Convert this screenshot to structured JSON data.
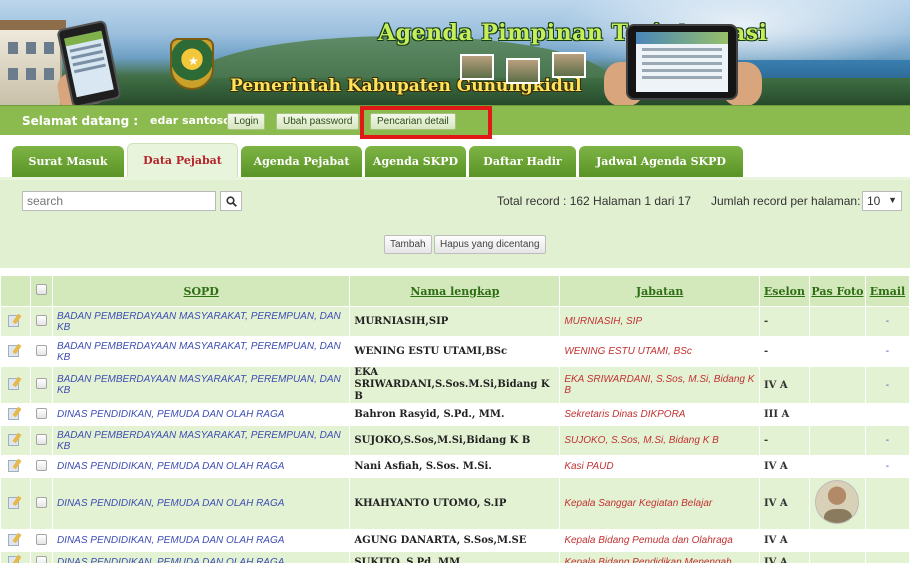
{
  "header": {
    "title": "Agenda Pimpinan Terintegrasi",
    "subtitle": "Pemerintah Kabupaten Gunungkidul"
  },
  "userbar": {
    "greeting": "Selamat datang :",
    "username": "edar santoso",
    "login_label": "Login",
    "change_password_label": "Ubah password",
    "detail_search_label": "Pencarian detail"
  },
  "tabs": [
    {
      "label": "Surat Masuk",
      "active": false
    },
    {
      "label": "Data Pejabat",
      "active": true
    },
    {
      "label": "Agenda Pejabat",
      "active": false
    },
    {
      "label": "Agenda SKPD",
      "active": false
    },
    {
      "label": "Daftar Hadir",
      "active": false
    },
    {
      "label": "Jadwal Agenda SKPD",
      "active": false
    }
  ],
  "search": {
    "placeholder": "search",
    "value": ""
  },
  "paging": {
    "summary": "Total record : 162  Halaman 1 dari 17",
    "per_page_label": "Jumlah record per halaman:",
    "per_page_value": "10"
  },
  "actions": {
    "add_label": "Tambah",
    "delete_checked_label": "Hapus yang dicentang"
  },
  "table": {
    "headers": {
      "sopd": "SOPD",
      "nama": "Nama lengkap",
      "jabatan": "Jabatan",
      "eselon": "Eselon",
      "foto": "Pas Foto",
      "email": "Email"
    },
    "rows": [
      {
        "sopd": "BADAN PEMBERDAYAAN MASYARAKAT, PEREMPUAN, DAN KB",
        "nama": "MURNIASIH,SIP",
        "jabatan": "MURNIASIH, SIP",
        "eselon": "-",
        "email": "-"
      },
      {
        "sopd": "BADAN PEMBERDAYAAN MASYARAKAT, PEREMPUAN, DAN KB",
        "nama": "WENING ESTU UTAMI,BSc",
        "jabatan": "WENING ESTU UTAMI, BSc",
        "eselon": "-",
        "email": "-"
      },
      {
        "sopd": "BADAN PEMBERDAYAAN MASYARAKAT, PEREMPUAN, DAN KB",
        "nama": "EKA SRIWARDANI,S.Sos.M.Si,Bidang K B",
        "jabatan": "EKA SRIWARDANI, S.Sos, M.Si, Bidang K B",
        "eselon": "IV A",
        "email": "-"
      },
      {
        "sopd": "DINAS PENDIDIKAN, PEMUDA DAN OLAH RAGA",
        "nama": "Bahron Rasyid, S.Pd., MM.",
        "jabatan": "Sekretaris Dinas DIKPORA",
        "eselon": "III A",
        "email": ""
      },
      {
        "sopd": "BADAN PEMBERDAYAAN MASYARAKAT, PEREMPUAN, DAN KB",
        "nama": "SUJOKO,S.Sos,M.Si,Bidang K B",
        "jabatan": "SUJOKO, S.Sos, M.Si, Bidang K B",
        "eselon": "-",
        "email": "-"
      },
      {
        "sopd": "DINAS PENDIDIKAN, PEMUDA DAN OLAH RAGA",
        "nama": "Nani Asfiah, S.Sos. M.Si.",
        "jabatan": "Kasi PAUD",
        "eselon": "IV A",
        "email": "-"
      },
      {
        "sopd": "DINAS PENDIDIKAN, PEMUDA DAN OLAH RAGA",
        "nama": "KHAHYANTO UTOMO, S.IP",
        "jabatan": "Kepala Sanggar Kegiatan Belajar",
        "eselon": "IV A",
        "email": ""
      },
      {
        "sopd": "DINAS PENDIDIKAN, PEMUDA DAN OLAH RAGA",
        "nama": "AGUNG DANARTA, S.Sos,M.SE",
        "jabatan": "Kepala Bidang Pemuda dan Olahraga",
        "eselon": "IV A",
        "email": ""
      },
      {
        "sopd": "DINAS PENDIDIKAN, PEMUDA DAN OLAH RAGA",
        "nama": "SUKITO, S.Pd, MM",
        "jabatan": "Kepala Bidang Pendidikan Menengah",
        "eselon": "IV A",
        "email": ""
      }
    ]
  },
  "colors": {
    "green_dark": "#5a9326",
    "green_light": "#e4f2d4",
    "active_tab_text": "#b4232a",
    "highlight_box": "#e01818",
    "sopd_text": "#3d4db3",
    "jabatan_text": "#c23232"
  }
}
